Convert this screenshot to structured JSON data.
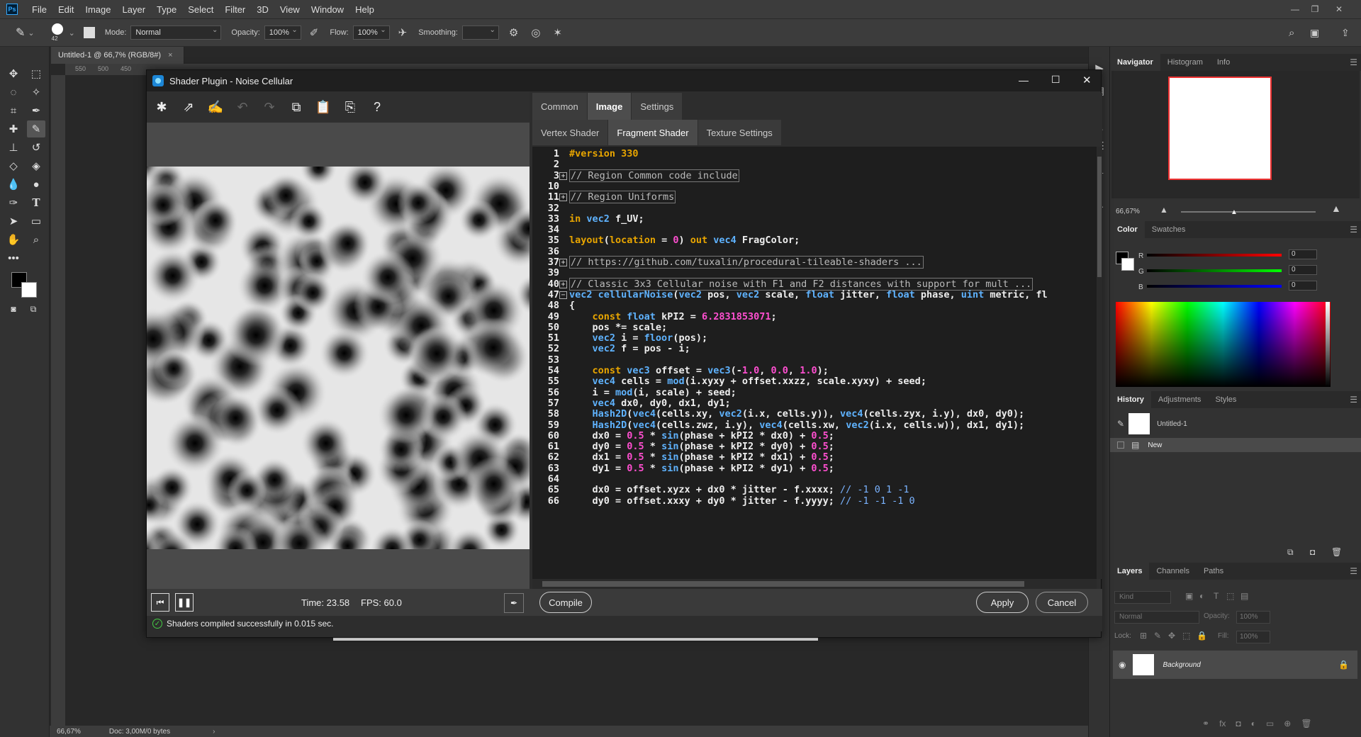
{
  "app": {
    "menu": [
      "File",
      "Edit",
      "Image",
      "Layer",
      "Type",
      "Select",
      "Filter",
      "3D",
      "View",
      "Window",
      "Help"
    ],
    "ps_logo": "Ps"
  },
  "options": {
    "brush_size": "42",
    "mode_label": "Mode:",
    "mode_value": "Normal",
    "opacity_label": "Opacity:",
    "opacity_value": "100%",
    "flow_label": "Flow:",
    "flow_value": "100%",
    "smoothing_label": "Smoothing:"
  },
  "document": {
    "tab_title": "Untitled-1 @ 66,7% (RGB/8#)",
    "ruler_marks": [
      "550",
      "500",
      "450"
    ],
    "status_zoom": "66,67%",
    "status_doc": "Doc: 3,00M/0 bytes"
  },
  "dialog": {
    "title": "Shader Plugin - Noise Cellular",
    "tabs_top": [
      "Common",
      "Image",
      "Settings"
    ],
    "tabs_top_active": "Image",
    "tabs_sub": [
      "Vertex Shader",
      "Fragment Shader",
      "Texture Settings"
    ],
    "tabs_sub_active": "Fragment Shader",
    "time_text": "Time: 23.58",
    "fps_text": "FPS: 60.0",
    "compile_label": "Compile",
    "apply_label": "Apply",
    "cancel_label": "Cancel",
    "status_message": "Shaders compiled successfully in 0.015 sec.",
    "code_lines": [
      {
        "n": "1",
        "t": "#version 330"
      },
      {
        "n": "2",
        "t": ""
      },
      {
        "n": "3",
        "t": "// Region Common code include",
        "fold": "+"
      },
      {
        "n": "10",
        "t": ""
      },
      {
        "n": "11",
        "t": "// Region Uniforms",
        "fold": "+"
      },
      {
        "n": "32",
        "t": ""
      },
      {
        "n": "33",
        "t": "in vec2 f_UV;"
      },
      {
        "n": "34",
        "t": ""
      },
      {
        "n": "35",
        "t": "layout(location = 0) out vec4 FragColor;"
      },
      {
        "n": "36",
        "t": ""
      },
      {
        "n": "37",
        "t": "// https://github.com/tuxalin/procedural-tileable-shaders ...",
        "fold": "+"
      },
      {
        "n": "39",
        "t": ""
      },
      {
        "n": "40",
        "t": "// Classic 3x3 Cellular noise with F1 and F2 distances with support for mult ...",
        "fold": "+"
      },
      {
        "n": "47",
        "t": "vec2 cellularNoise(vec2 pos, vec2 scale, float jitter, float phase, uint metric, fl",
        "fold": "-"
      },
      {
        "n": "48",
        "t": "{"
      },
      {
        "n": "49",
        "t": "    const float kPI2 = 6.2831853071;"
      },
      {
        "n": "50",
        "t": "    pos *= scale;"
      },
      {
        "n": "51",
        "t": "    vec2 i = floor(pos);"
      },
      {
        "n": "52",
        "t": "    vec2 f = pos - i;"
      },
      {
        "n": "53",
        "t": ""
      },
      {
        "n": "54",
        "t": "    const vec3 offset = vec3(-1.0, 0.0, 1.0);"
      },
      {
        "n": "55",
        "t": "    vec4 cells = mod(i.xyxy + offset.xxzz, scale.xyxy) + seed;"
      },
      {
        "n": "56",
        "t": "    i = mod(i, scale) + seed;"
      },
      {
        "n": "57",
        "t": "    vec4 dx0, dy0, dx1, dy1;"
      },
      {
        "n": "58",
        "t": "    Hash2D(vec4(cells.xy, vec2(i.x, cells.y)), vec4(cells.zyx, i.y), dx0, dy0);"
      },
      {
        "n": "59",
        "t": "    Hash2D(vec4(cells.zwz, i.y), vec4(cells.xw, vec2(i.x, cells.w)), dx1, dy1);"
      },
      {
        "n": "60",
        "t": "    dx0 = 0.5 * sin(phase + kPI2 * dx0) + 0.5;"
      },
      {
        "n": "61",
        "t": "    dy0 = 0.5 * sin(phase + kPI2 * dy0) + 0.5;"
      },
      {
        "n": "62",
        "t": "    dx1 = 0.5 * sin(phase + kPI2 * dx1) + 0.5;"
      },
      {
        "n": "63",
        "t": "    dy1 = 0.5 * sin(phase + kPI2 * dy1) + 0.5;"
      },
      {
        "n": "64",
        "t": ""
      },
      {
        "n": "65",
        "t": "    dx0 = offset.xyzx + dx0 * jitter - f.xxxx; // -1 0 1 -1"
      },
      {
        "n": "66",
        "t": "    dy0 = offset.xxxy + dy0 * jitter - f.yyyy; // -1 -1 -1 0"
      }
    ]
  },
  "panels": {
    "navigator_tabs": [
      "Navigator",
      "Histogram",
      "Info"
    ],
    "nav_zoom": "66,67%",
    "color_tabs": [
      "Color",
      "Swatches"
    ],
    "color_r_label": "R",
    "color_g_label": "G",
    "color_b_label": "B",
    "color_r": "0",
    "color_g": "0",
    "color_b": "0",
    "history_tabs": [
      "History",
      "Adjustments",
      "Styles"
    ],
    "history_items": [
      "Untitled-1",
      "New"
    ],
    "layers_tabs": [
      "Layers",
      "Channels",
      "Paths"
    ],
    "layers_kind": "Kind",
    "layers_blend": "Normal",
    "layers_opacity_label": "Opacity:",
    "layers_opacity": "100%",
    "layers_lock_label": "Lock:",
    "layers_fill_label": "Fill:",
    "layers_fill": "100%",
    "layer_name": "Background"
  }
}
